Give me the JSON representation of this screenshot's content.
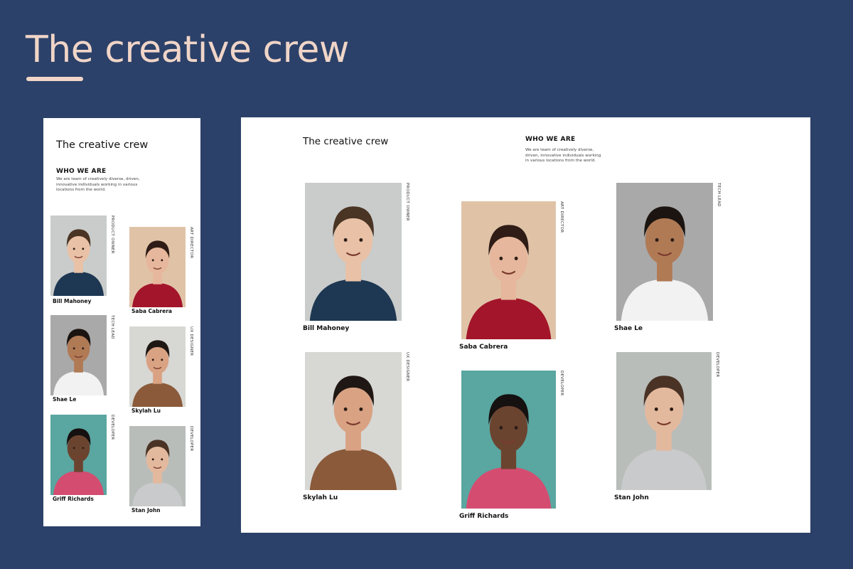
{
  "hero": {
    "title": "The creative crew"
  },
  "panel": {
    "title": "The creative crew",
    "about_heading": "WHO WE ARE",
    "about_text": "We are team of creatively diverse, driven, innovative individuals working in various locations from the world."
  },
  "members": [
    {
      "name": "Bill Mahoney",
      "role": "PRODUCT OWNER",
      "bg": "#c9ccca",
      "shirt": "#1e3752",
      "skin": "#e9c1a6",
      "hair": "#4a3424"
    },
    {
      "name": "Saba Cabrera",
      "role": "ART DIRECTOR",
      "bg": "#e0c3a7",
      "shirt": "#a3152a",
      "skin": "#e6b79c",
      "hair": "#2f1c16"
    },
    {
      "name": "Shae Le",
      "role": "TECH LEAD",
      "bg": "#a9a9a9",
      "shirt": "#f2f2f2",
      "skin": "#b07a55",
      "hair": "#1b1410"
    },
    {
      "name": "Skylah Lu",
      "role": "UX DESIGNER",
      "bg": "#d7d7d4",
      "shirt": "#8a5a3a",
      "skin": "#d9a283",
      "hair": "#1f1713"
    },
    {
      "name": "Griff Richards",
      "role": "DEVELOPER",
      "bg": "#5aa6a0",
      "shirt": "#d44d71",
      "skin": "#6b4430",
      "hair": "#151110"
    },
    {
      "name": "Stan John",
      "role": "DEVELOPER",
      "bg": "#b9bdba",
      "shirt": "#c8cacc",
      "skin": "#e3b99e",
      "hair": "#4a3325"
    }
  ]
}
